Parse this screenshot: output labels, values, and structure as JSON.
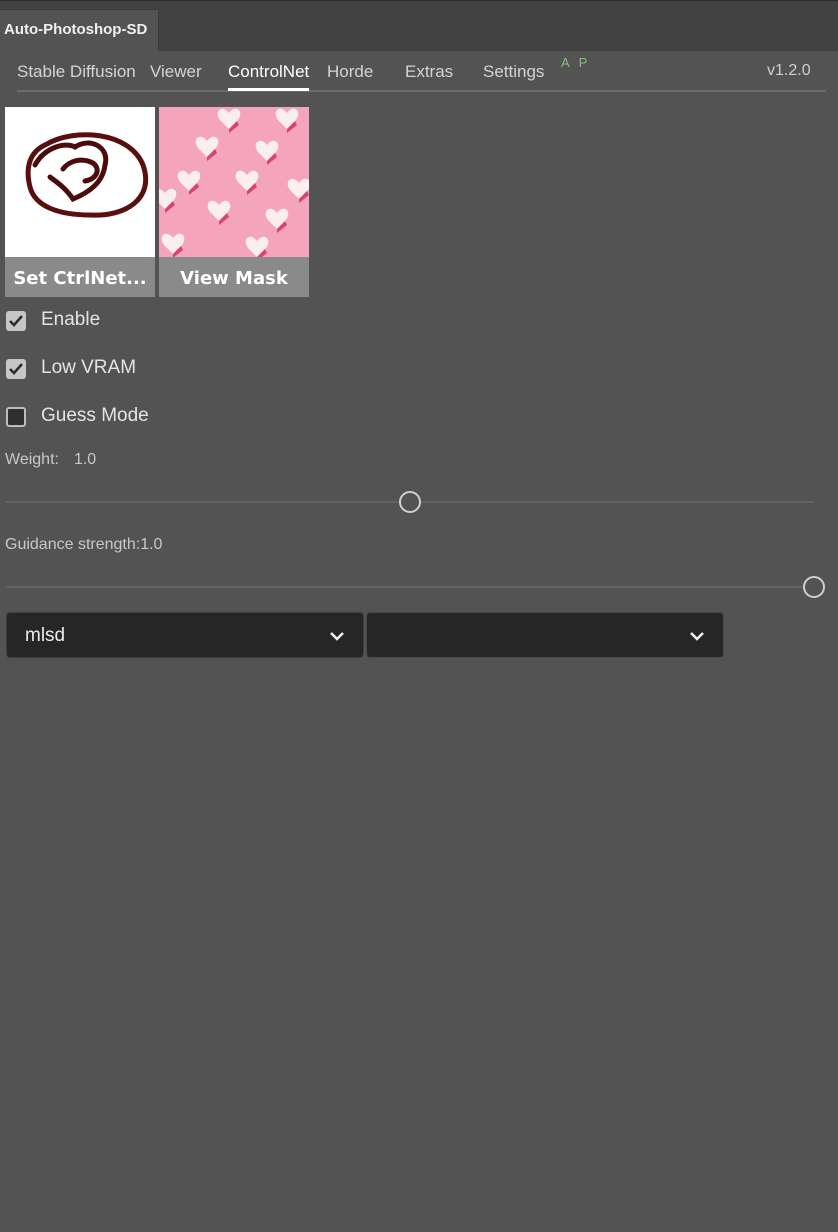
{
  "panel": {
    "title": "Auto-Photoshop-SD"
  },
  "nav": {
    "tabs": [
      "Stable Diffusion",
      "Viewer",
      "ControlNet",
      "Horde",
      "Extras",
      "Settings"
    ],
    "active": "ControlNet",
    "badge": "A P",
    "version": "v1.2.0"
  },
  "thumbnails": {
    "ctrlnet": {
      "label": "Set CtrlNet..."
    },
    "mask": {
      "label": "View Mask"
    }
  },
  "checkboxes": {
    "enable": {
      "label": "Enable",
      "checked": true
    },
    "low_vram": {
      "label": "Low VRAM",
      "checked": true
    },
    "guess_mode": {
      "label": "Guess Mode",
      "checked": false
    }
  },
  "weight": {
    "label": "Weight:",
    "value": "1.0",
    "slider_fraction": 0.5
  },
  "guidance": {
    "label": "Guidance strength:",
    "value": "1.0",
    "slider_fraction": 1.0
  },
  "selects": {
    "preprocessor": {
      "value": "mlsd"
    },
    "model": {
      "value": ""
    }
  },
  "colors": {
    "accent_green": "#7ec37e",
    "background": "#535353"
  }
}
